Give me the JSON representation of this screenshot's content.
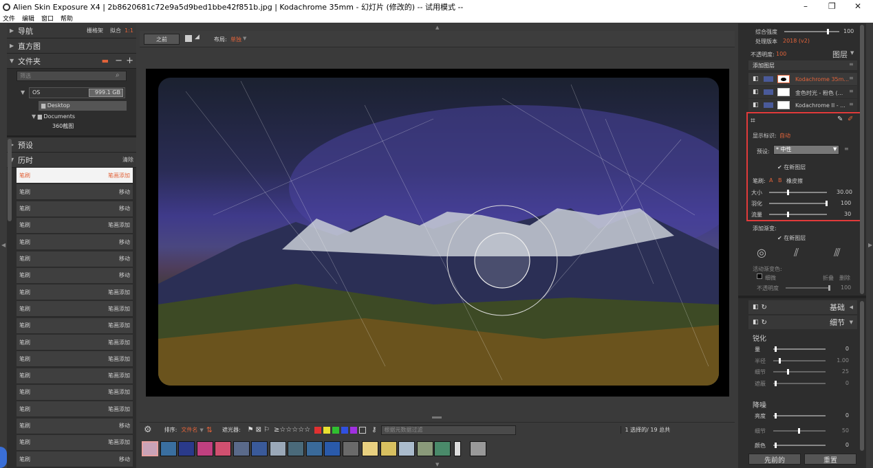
{
  "window": {
    "title": "Alien Skin Exposure X4 | 2b8620681c72e9a5d9bed1bbe42f851b.jpg | Kodachrome 35mm - 幻灯片 (修改的) -- 试用模式 --",
    "controls": [
      "–",
      "❐",
      "✕"
    ]
  },
  "menu": [
    "文件",
    "编辑",
    "窗口",
    "帮助"
  ],
  "left": {
    "nav_label": "导航",
    "nav_opts": [
      "栅格架",
      "拟合",
      "1:1"
    ],
    "histogram_label": "直方图",
    "folders_label": "文件夹",
    "filter_placeholder": "筛选",
    "drive_name": "OS",
    "drive_size": "999.1 GB",
    "folders": [
      "Desktop",
      "Documents",
      "360截图"
    ],
    "presets_label": "预设",
    "history_label": "历时",
    "history_clear": "清除",
    "history": [
      {
        "a": "笔刷",
        "b": "笔画添加"
      },
      {
        "a": "笔刷",
        "b": "移动"
      },
      {
        "a": "笔刷",
        "b": "移动"
      },
      {
        "a": "笔刷",
        "b": "笔画添加"
      },
      {
        "a": "笔刷",
        "b": "移动"
      },
      {
        "a": "笔刷",
        "b": "移动"
      },
      {
        "a": "笔刷",
        "b": "移动"
      },
      {
        "a": "笔刷",
        "b": "笔画添加"
      },
      {
        "a": "笔刷",
        "b": "笔画添加"
      },
      {
        "a": "笔刷",
        "b": "笔画添加"
      },
      {
        "a": "笔刷",
        "b": "笔画添加"
      },
      {
        "a": "笔刷",
        "b": "笔画添加"
      },
      {
        "a": "笔刷",
        "b": "笔画添加"
      },
      {
        "a": "笔刷",
        "b": "笔画添加"
      },
      {
        "a": "笔刷",
        "b": "笔画添加"
      },
      {
        "a": "笔刷",
        "b": "移动"
      },
      {
        "a": "笔刷",
        "b": "笔画添加"
      },
      {
        "a": "笔刷",
        "b": "移动"
      }
    ]
  },
  "center": {
    "before_btn": "之前",
    "layout_label": "布局:",
    "layout_value": "单独",
    "sort_label": "排序:",
    "sort_value": "文件名",
    "filter_label": "遮光器:",
    "stars": "≥☆☆☆☆☆",
    "search_placeholder": "根据元数据过滤",
    "selection_count": "1 选择的/ 19 总共"
  },
  "right": {
    "overall_label": "综合强度",
    "overall_value": "100",
    "process_label": "处理版本",
    "process_value": "2018 (v2)",
    "opacity_label": "不透明度:",
    "opacity_value": "100",
    "layers_label": "图层",
    "add_layer": "添加图层",
    "layers": [
      "Kodachrome 35m...",
      "金色时光 - 粉色 (...",
      "Kodachrome II - ..."
    ],
    "show_mask_label": "显示标识:",
    "show_mask_value": "自动",
    "preset_label": "预设:",
    "preset_value": "* 中性",
    "new_layer_1": "在新图层",
    "brush_label": "笔刷:",
    "brush_a": "A",
    "brush_b": "B",
    "eraser": "橡皮擦",
    "size_label": "大小",
    "size_value": "30.00",
    "feather_label": "羽化",
    "feather_value": "100",
    "flow_label": "流量",
    "flow_value": "30",
    "add_grad_label": "添加渐变:",
    "new_layer_2": "在新图层",
    "active_grad_label": "活动渐变色:",
    "fine_label": "细微",
    "fold_label": "折叠",
    "delete_label": "删除",
    "grad_opacity_label": "不透明度",
    "grad_opacity_value": "100",
    "basic_label": "基础",
    "detail_label": "细节",
    "sharpen_label": "锐化",
    "sharpen_rows": [
      {
        "label": "量",
        "value": "0"
      },
      {
        "label": "半径",
        "value": "1.00"
      },
      {
        "label": "细节",
        "value": "25"
      },
      {
        "label": "遮蔽",
        "value": "0"
      }
    ],
    "noise_label": "降噪",
    "noise_rows": [
      {
        "label": "亮度",
        "value": "0"
      },
      {
        "label": "细节",
        "value": "50"
      },
      {
        "label": "颜色",
        "value": "0"
      }
    ],
    "prev_btn": "先前的",
    "reset_btn": "重置"
  },
  "colors": {
    "accent": "#e2633a",
    "highlight_box": "#e23a3a"
  }
}
